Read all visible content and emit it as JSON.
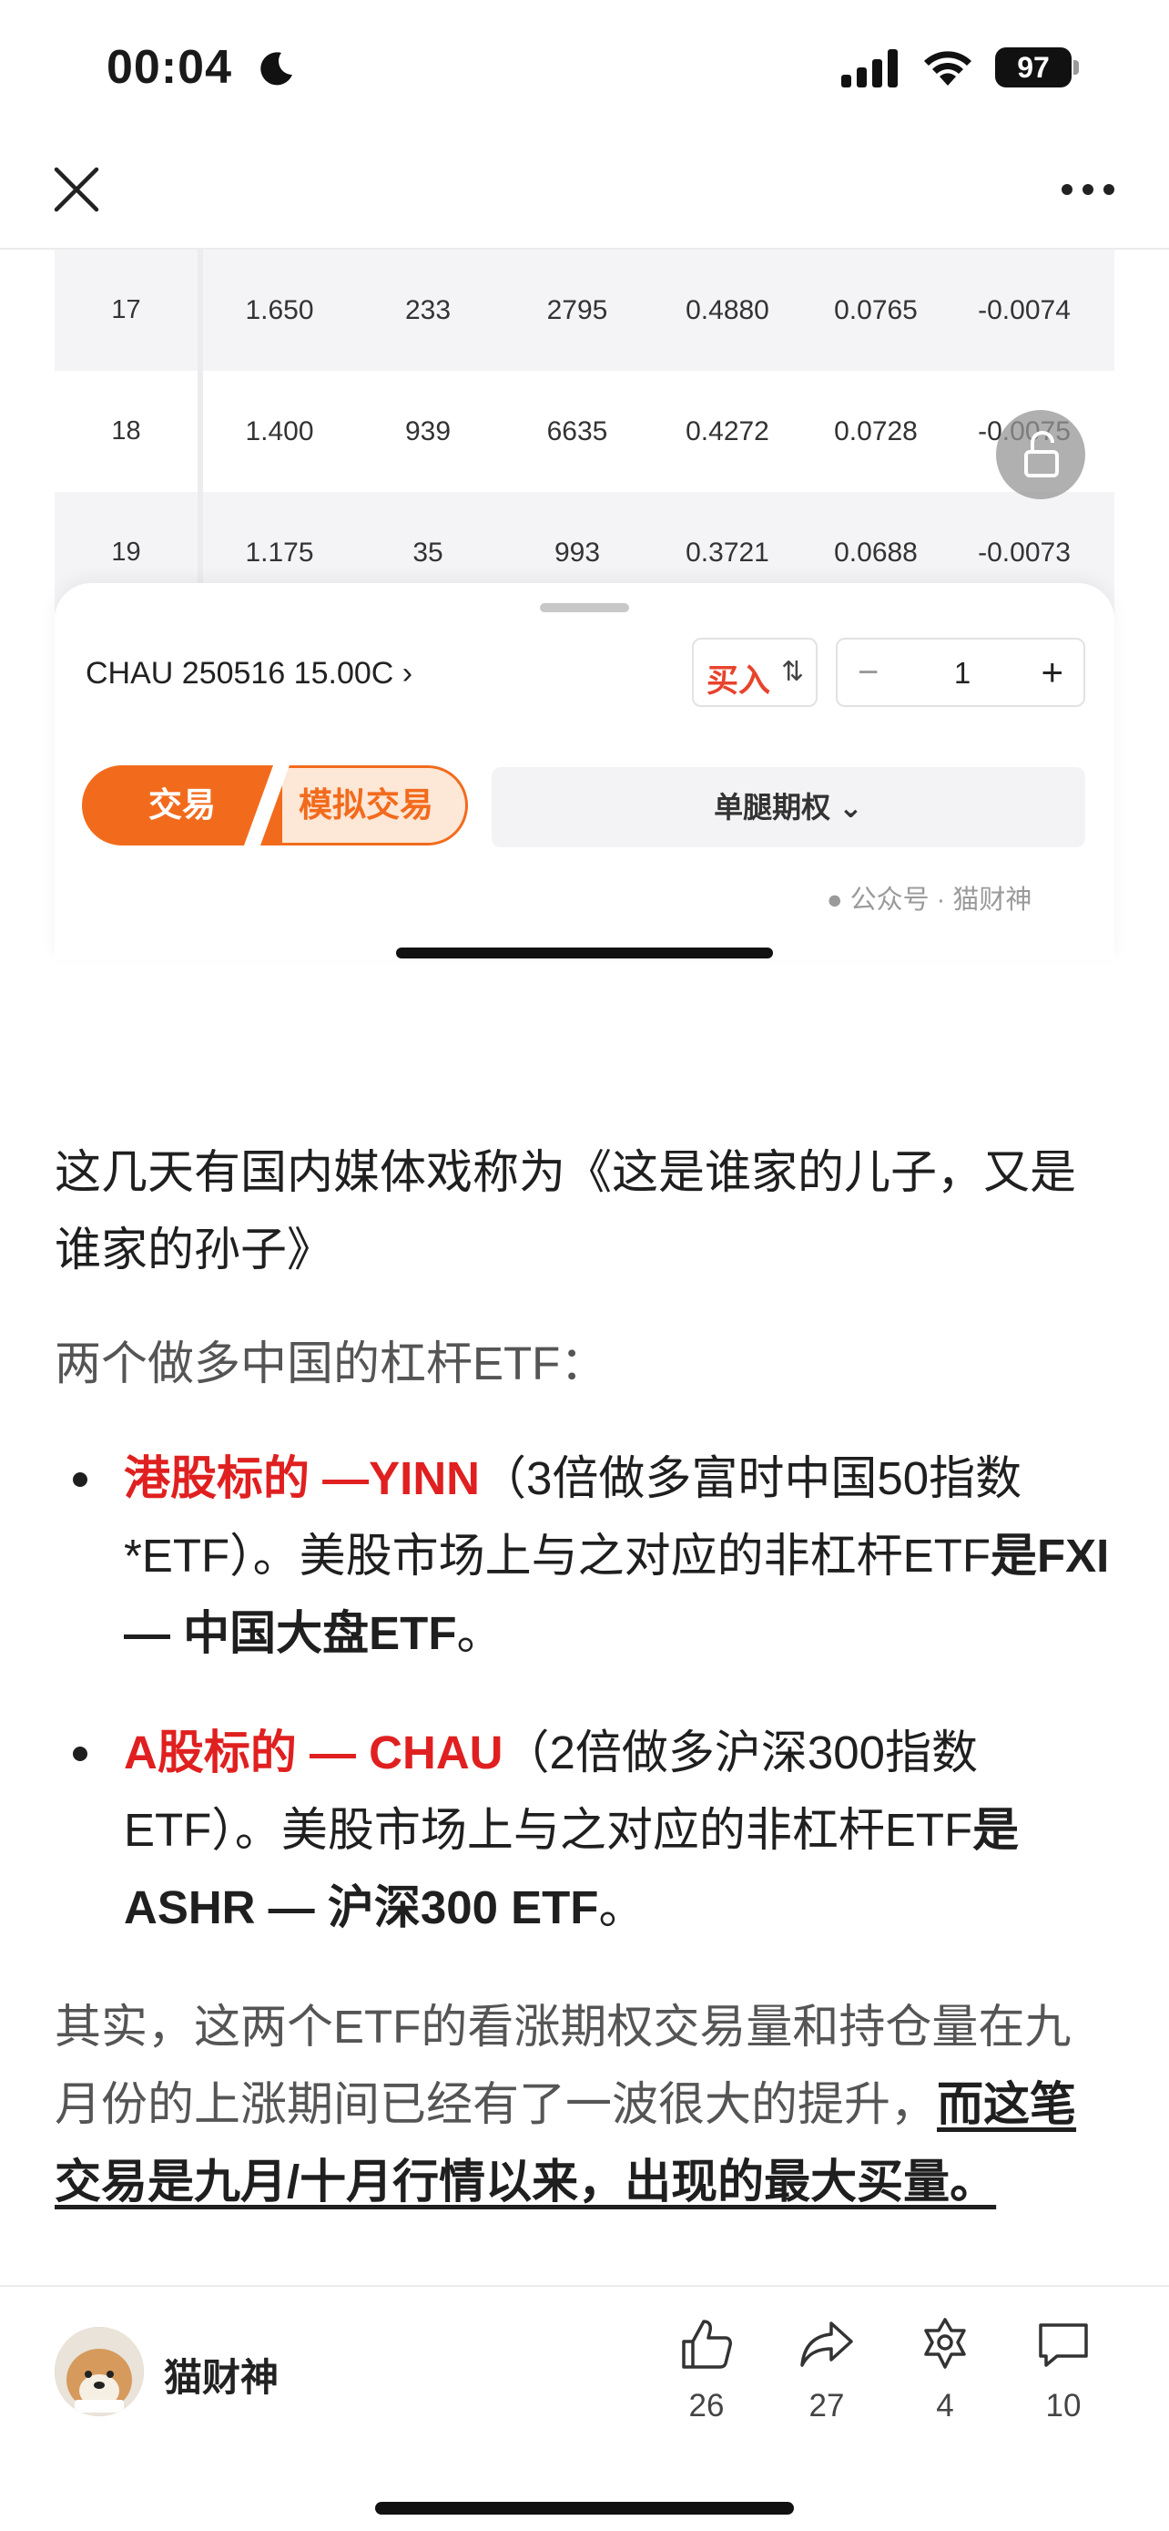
{
  "status_bar": {
    "time": "00:04",
    "battery": "97"
  },
  "table": {
    "rows": [
      {
        "index": "17",
        "cells": [
          "1.650",
          "233",
          "2795",
          "0.4880",
          "0.0765",
          "-0.0074"
        ]
      },
      {
        "index": "18",
        "cells": [
          "1.400",
          "939",
          "6635",
          "0.4272",
          "0.0728",
          "-0.0075"
        ]
      },
      {
        "index": "19",
        "cells": [
          "1.175",
          "35",
          "993",
          "0.3721",
          "0.0688",
          "-0.0073"
        ]
      }
    ]
  },
  "trade": {
    "contract": "CHAU 250516 15.00C",
    "buy_label": "买入",
    "quantity": "1",
    "tab_trade": "交易",
    "tab_sim": "模拟交易",
    "leg_select": "单腿期权",
    "watermark": "公众号 · 猫财神"
  },
  "article": {
    "p1": "这几天有国内媒体戏称为《这是谁家的儿子，又是谁家的孙子》",
    "p2": "两个做多中国的杠杆ETF：",
    "b1_red": "港股标的 —YINN",
    "b1_text": "（3倍做多富时中国50指数*ETF）。美股市场上与之对应的非杠杆ETF",
    "b1_bold": "是FXI — 中国大盘ETF",
    "b1_end": "。",
    "b2_red": "A股标的 — CHAU",
    "b2_text": "（2倍做多沪深300指数ETF）。美股市场上与之对应的非杠杆ETF",
    "b2_bold": "是ASHR — 沪深300 ETF",
    "b2_end": "。",
    "p3_text": "其实，这两个ETF的看涨期权交易量和持仓量在九月份的上涨期间已经有了一波很大的提升，",
    "p3_underline": "而这笔交易是九月/十月行情以来，出现的最大买量。"
  },
  "bottom": {
    "author": "猫财神",
    "likes": "26",
    "shares": "27",
    "favorites": "4",
    "comments": "10"
  }
}
